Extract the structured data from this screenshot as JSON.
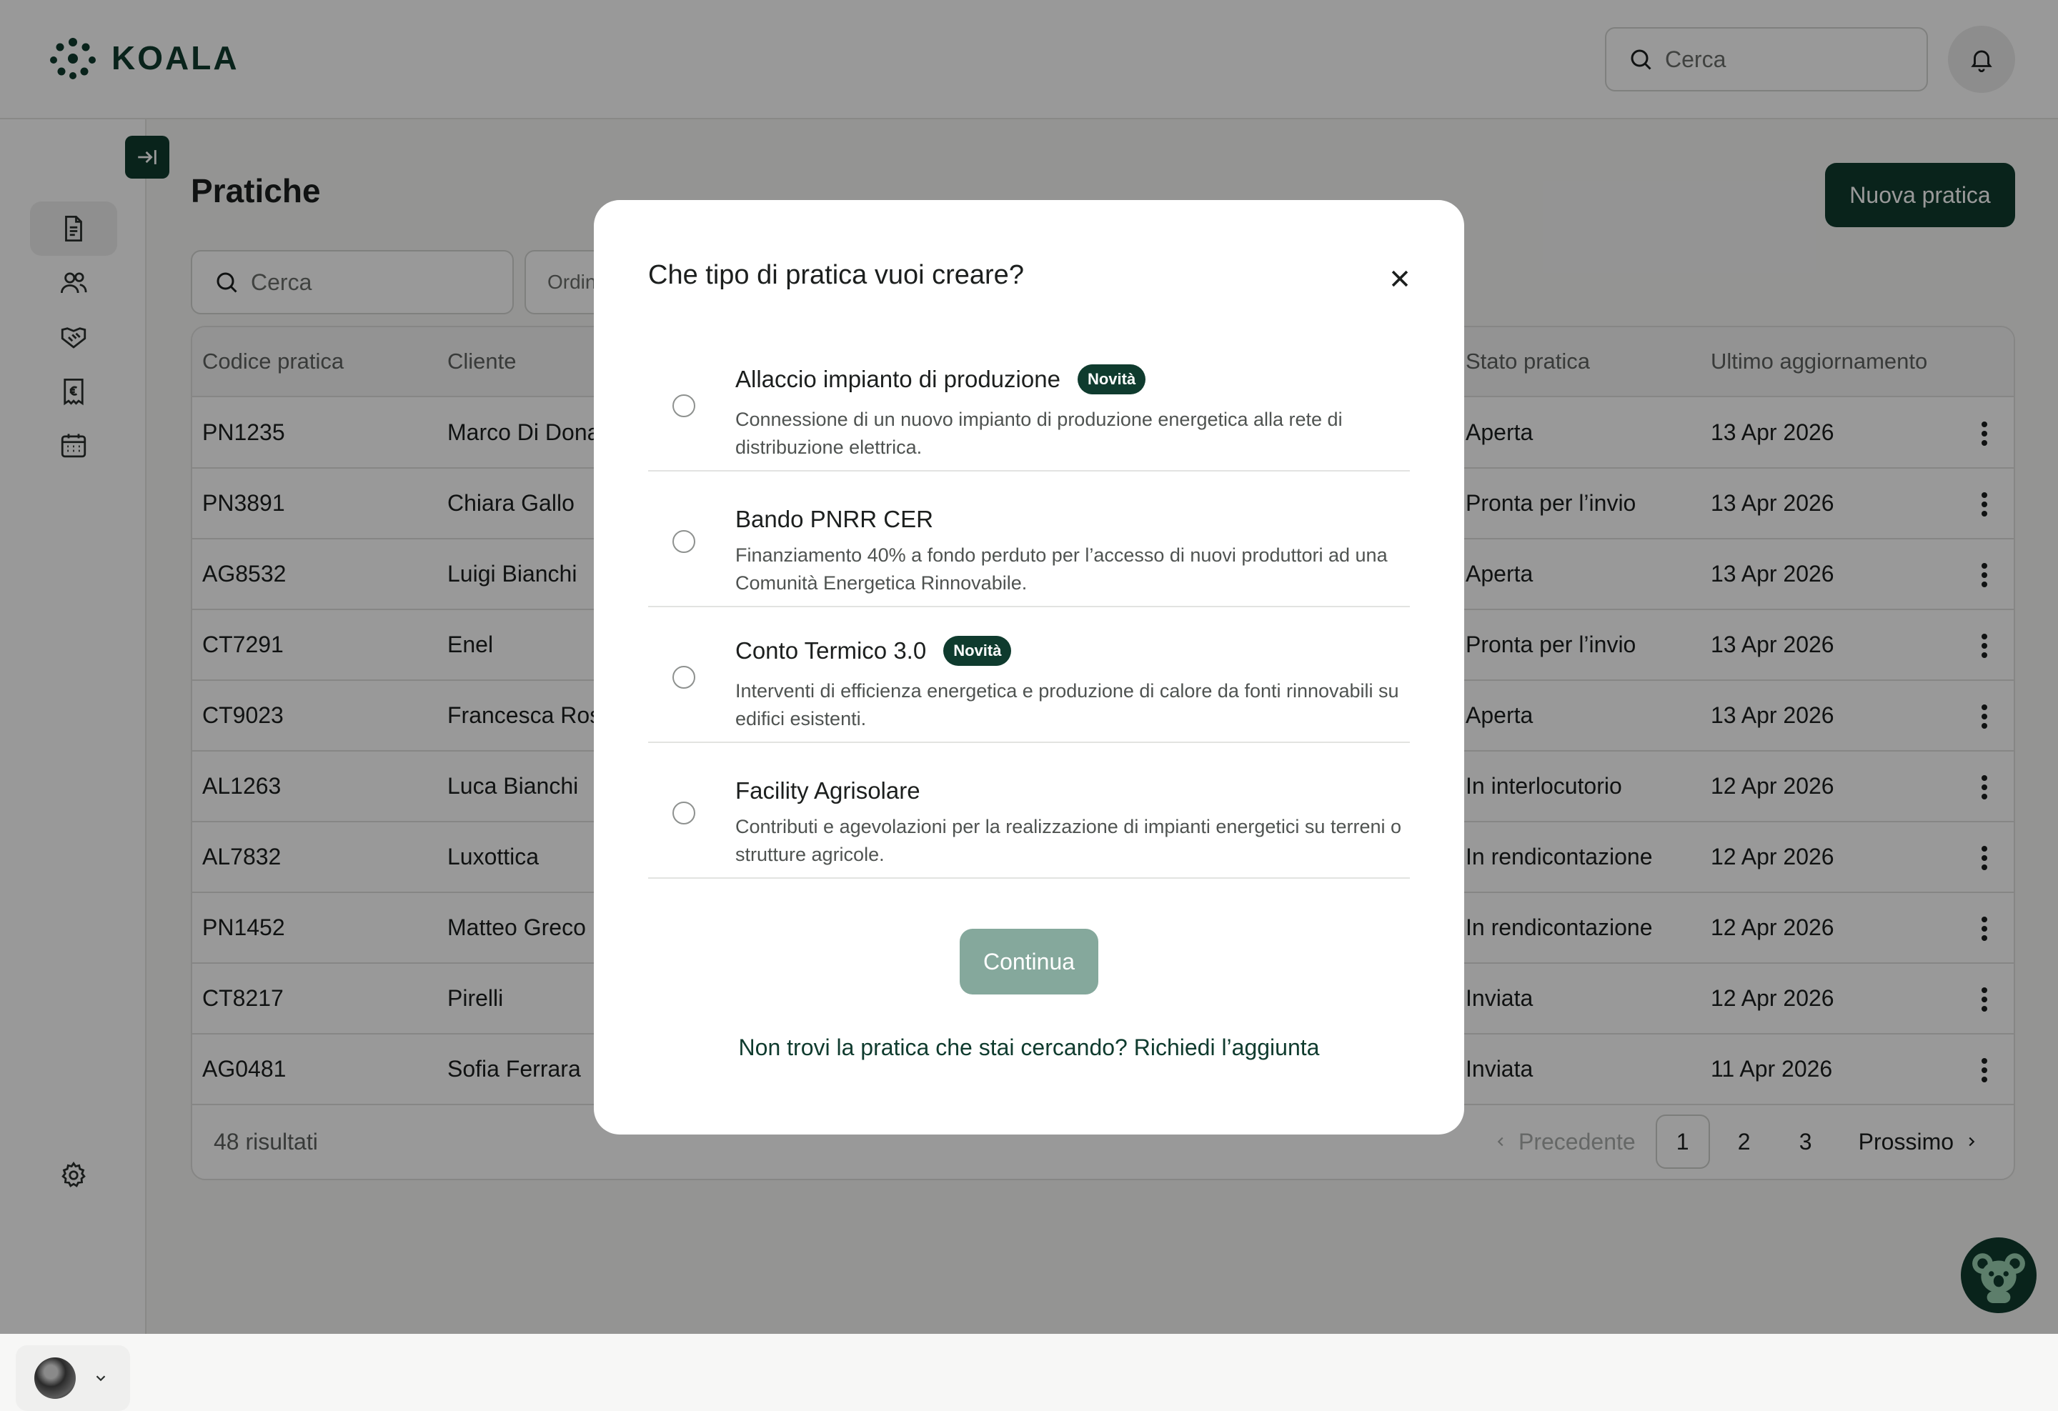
{
  "app": {
    "name": "KOALA"
  },
  "header": {
    "search_placeholder": "Cerca"
  },
  "page": {
    "title": "Pratiche",
    "new_button": "Nuova pratica",
    "search_placeholder": "Cerca",
    "order_label": "Ordin"
  },
  "table": {
    "columns": [
      "Codice pratica",
      "Cliente",
      "Stato pratica",
      "Ultimo aggiornamento"
    ],
    "rows": [
      {
        "code": "PN1235",
        "client": "Marco Di Dona",
        "status": "Aperta",
        "updated": "13 Apr 2026"
      },
      {
        "code": "PN3891",
        "client": "Chiara Gallo",
        "status": "Pronta per l’invio",
        "updated": "13 Apr 2026"
      },
      {
        "code": "AG8532",
        "client": "Luigi Bianchi",
        "status": "Aperta",
        "updated": "13 Apr 2026"
      },
      {
        "code": "CT7291",
        "client": "Enel",
        "status": "Pronta per l’invio",
        "updated": "13 Apr 2026"
      },
      {
        "code": "CT9023",
        "client": "Francesca Ros",
        "status": "Aperta",
        "updated": "13 Apr 2026"
      },
      {
        "code": "AL1263",
        "client": "Luca Bianchi",
        "status": "In interlocutorio",
        "updated": "12 Apr 2026"
      },
      {
        "code": "AL7832",
        "client": "Luxottica",
        "status": "In rendicontazione",
        "updated": "12 Apr 2026"
      },
      {
        "code": "PN1452",
        "client": "Matteo Greco",
        "status": "In rendicontazione",
        "updated": "12 Apr 2026"
      },
      {
        "code": "CT8217",
        "client": "Pirelli",
        "status": "Inviata",
        "updated": "12 Apr 2026"
      },
      {
        "code": "AG0481",
        "client": "Sofia Ferrara",
        "status": "Inviata",
        "updated": "11 Apr 2026"
      }
    ],
    "results": "48 risultati",
    "pagination": {
      "prev": "Precedente",
      "pages": [
        "1",
        "2",
        "3"
      ],
      "current": "1",
      "next": "Prossimo"
    }
  },
  "modal": {
    "title": "Che tipo di pratica vuoi creare?",
    "options": [
      {
        "title": "Allaccio impianto di produzione",
        "badge": "Novità",
        "description": "Connessione di un nuovo impianto di produzione energetica alla rete di distribuzione elettrica."
      },
      {
        "title": "Bando PNRR CER",
        "badge": "",
        "description": "Finanziamento 40% a fondo perduto per l’accesso di nuovi produttori ad una Comunità Energetica Rinnovabile."
      },
      {
        "title": "Conto Termico 3.0",
        "badge": "Novità",
        "description": "Interventi di efficienza energetica e produzione di calore da fonti rinnovabili su edifici esistenti."
      },
      {
        "title": "Facility Agrisolare",
        "badge": "",
        "description": "Contributi e agevolazioni per la realizzazione di impianti energetici su terreni o strutture agricole."
      }
    ],
    "continue_button": "Continua",
    "help_link": "Non trovi la pratica che stai cercando? Richiedi l’aggiunta"
  },
  "colors": {
    "brand": "#0f3b2e",
    "continue_disabled": "#85a89c",
    "overlay": "rgba(0,0,0,0.40)"
  },
  "icons": [
    "koala-logo-icon",
    "search-icon",
    "bell-icon",
    "collapse-sidebar-icon",
    "document-icon",
    "users-icon",
    "handshake-icon",
    "euro-receipt-icon",
    "calendar-icon",
    "gear-icon",
    "chevron-down-icon",
    "kebab-menu-icon",
    "close-icon",
    "chevron-left-icon",
    "chevron-right-icon",
    "koala-assistant-icon"
  ]
}
